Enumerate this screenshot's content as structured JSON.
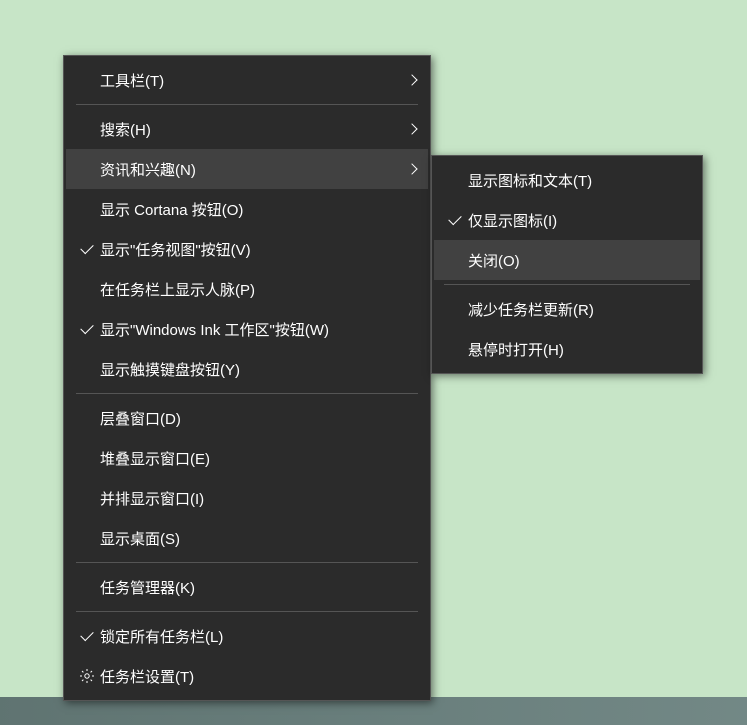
{
  "main_menu": {
    "toolbar": "工具栏(T)",
    "search": "搜索(H)",
    "news": "资讯和兴趣(N)",
    "cortana": "显示 Cortana 按钮(O)",
    "taskview": "显示\"任务视图\"按钮(V)",
    "people": "在任务栏上显示人脉(P)",
    "ink": "显示\"Windows Ink 工作区\"按钮(W)",
    "touchkb": "显示触摸键盘按钮(Y)",
    "cascade": "层叠窗口(D)",
    "stacked": "堆叠显示窗口(E)",
    "sidebyside": "并排显示窗口(I)",
    "desktop": "显示桌面(S)",
    "taskmgr": "任务管理器(K)",
    "lock": "锁定所有任务栏(L)",
    "settings": "任务栏设置(T)"
  },
  "sub_menu": {
    "icon_text": "显示图标和文本(T)",
    "icon_only": "仅显示图标(I)",
    "off": "关闭(O)",
    "reduce": "减少任务栏更新(R)",
    "hover": "悬停时打开(H)"
  }
}
